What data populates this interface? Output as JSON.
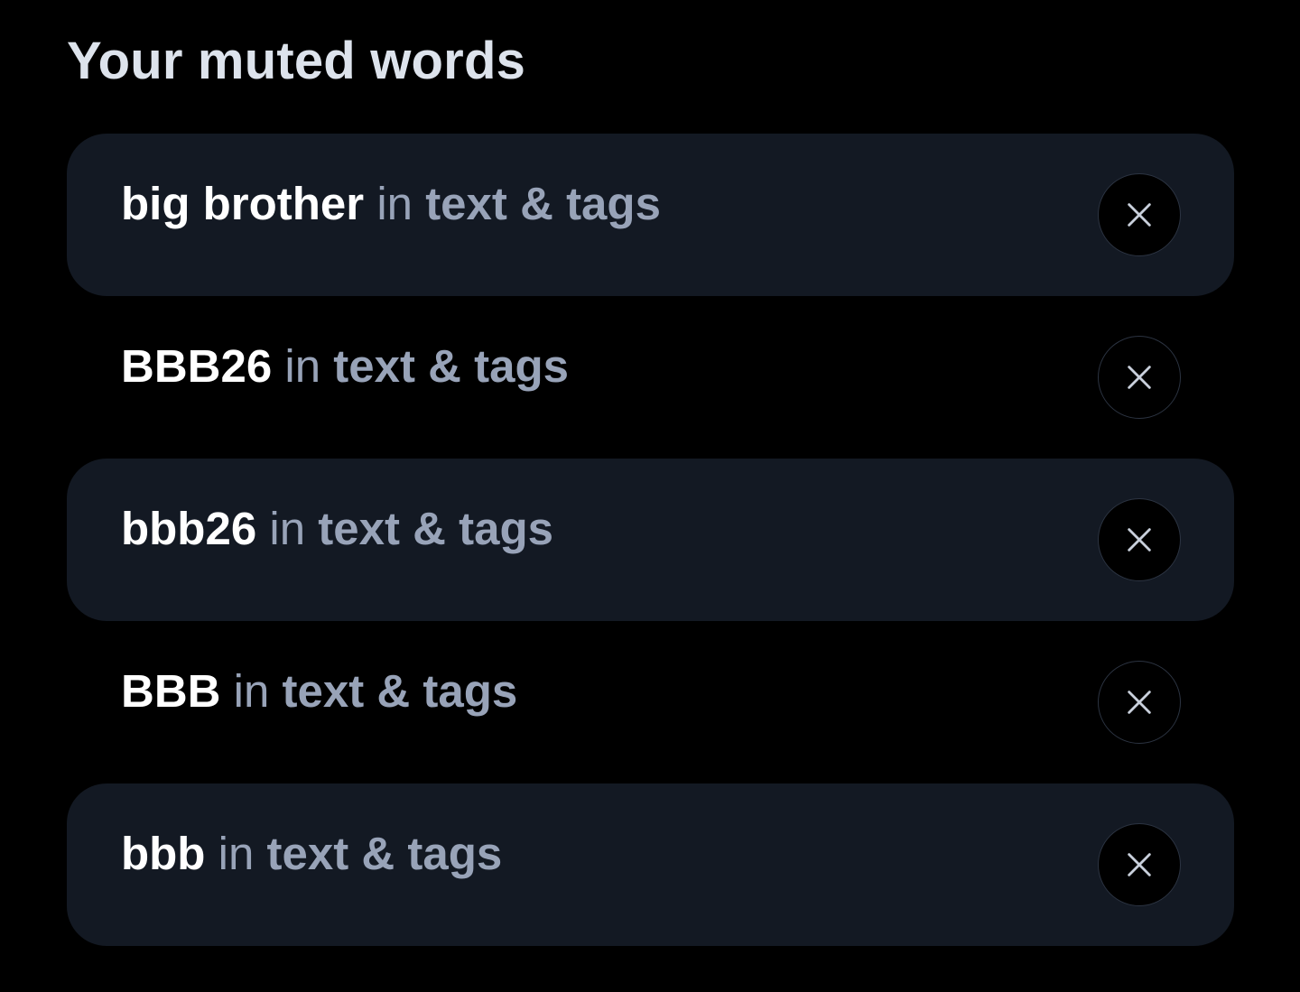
{
  "title": "Your muted words",
  "in_label": "in",
  "icons": {
    "remove": "close-icon"
  },
  "colors": {
    "background": "#000000",
    "row_shaded": "#131923",
    "term": "#ffffff",
    "secondary": "#98a3b8",
    "title": "#dde3ec"
  },
  "muted_words": [
    {
      "term": "big brother",
      "target": "text & tags"
    },
    {
      "term": "BBB26",
      "target": "text & tags"
    },
    {
      "term": "bbb26",
      "target": "text & tags"
    },
    {
      "term": "BBB",
      "target": "text & tags"
    },
    {
      "term": "bbb",
      "target": "text & tags"
    }
  ]
}
